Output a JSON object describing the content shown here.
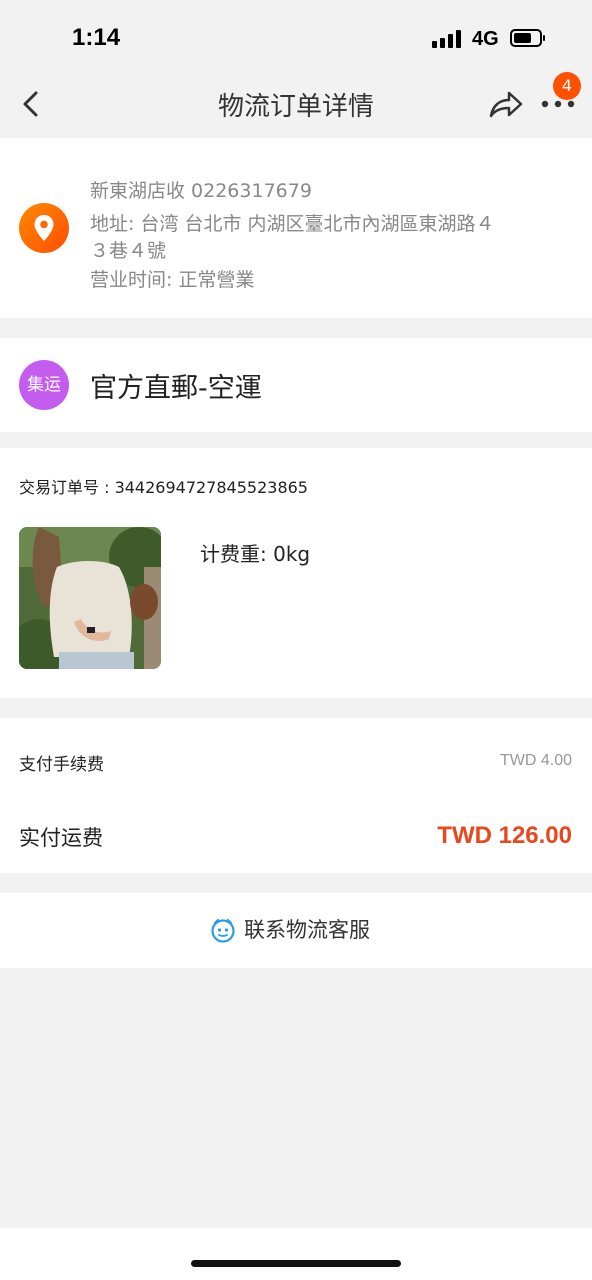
{
  "status_bar": {
    "time": "1:14",
    "network": "4G"
  },
  "nav": {
    "title": "物流订单详情",
    "badge_count": "4"
  },
  "address": {
    "store_line": "新東湖店收  0226317679",
    "address_line1": "地址: 台湾 台北市 内湖区臺北市內湖區東湖路４",
    "address_line2": "３巷４號",
    "hours_line": "营业时间: 正常營業"
  },
  "shipping": {
    "badge_text": "集运",
    "method": "官方直郵-空運"
  },
  "order": {
    "order_no": "交易订单号 : 3442694727845523865",
    "weight": "计费重: 0kg"
  },
  "fees": {
    "fee_label": "支付手续费",
    "fee_value": "TWD 4.00",
    "pay_label": "实付运费",
    "pay_value": "TWD 126.00"
  },
  "contact": {
    "label": "联系物流客服"
  },
  "colors": {
    "accent": "#ff5000",
    "price": "#e8481b",
    "ship_badge": "#c45cf0"
  }
}
